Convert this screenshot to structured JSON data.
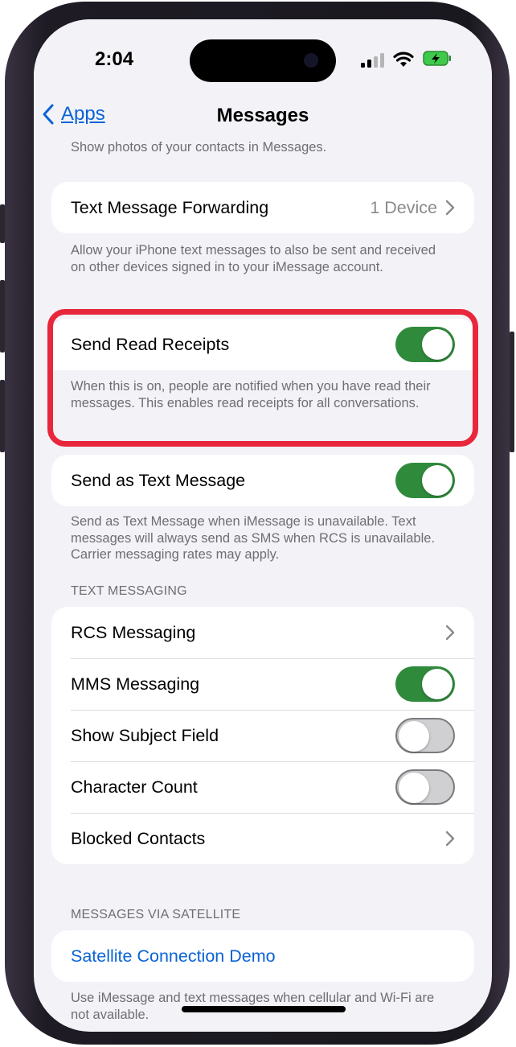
{
  "status": {
    "time": "2:04"
  },
  "nav": {
    "back_label": "Apps",
    "title": "Messages"
  },
  "top_footnote": "Show photos of your contacts in Messages.",
  "forwarding": {
    "label": "Text Message Forwarding",
    "value": "1 Device",
    "footnote": "Allow your iPhone text messages to also be sent and received on other devices signed in to your iMessage account."
  },
  "read_receipts": {
    "label": "Send Read Receipts",
    "on": true,
    "footnote": "When this is on, people are notified when you have read their messages. This enables read receipts for all conversations."
  },
  "send_as_text": {
    "label": "Send as Text Message",
    "on": true,
    "footnote": "Send as Text Message when iMessage is unavailable. Text messages will always send as SMS when RCS is unavailable. Carrier messaging rates may apply."
  },
  "text_messaging": {
    "header": "TEXT MESSAGING",
    "rows": [
      {
        "label": "RCS Messaging",
        "type": "chevron"
      },
      {
        "label": "MMS Messaging",
        "type": "toggle",
        "on": true
      },
      {
        "label": "Show Subject Field",
        "type": "toggle",
        "on": false
      },
      {
        "label": "Character Count",
        "type": "toggle",
        "on": false
      },
      {
        "label": "Blocked Contacts",
        "type": "chevron"
      }
    ]
  },
  "satellite": {
    "header": "MESSAGES VIA SATELLITE",
    "link_label": "Satellite Connection Demo",
    "footnote": "Use iMessage and text messages when cellular and Wi-Fi are not available."
  },
  "colors": {
    "accent": "#0a63d6",
    "toggle_on": "#2f8a3c",
    "highlight": "#e8273c",
    "background": "#f2f2f7"
  }
}
